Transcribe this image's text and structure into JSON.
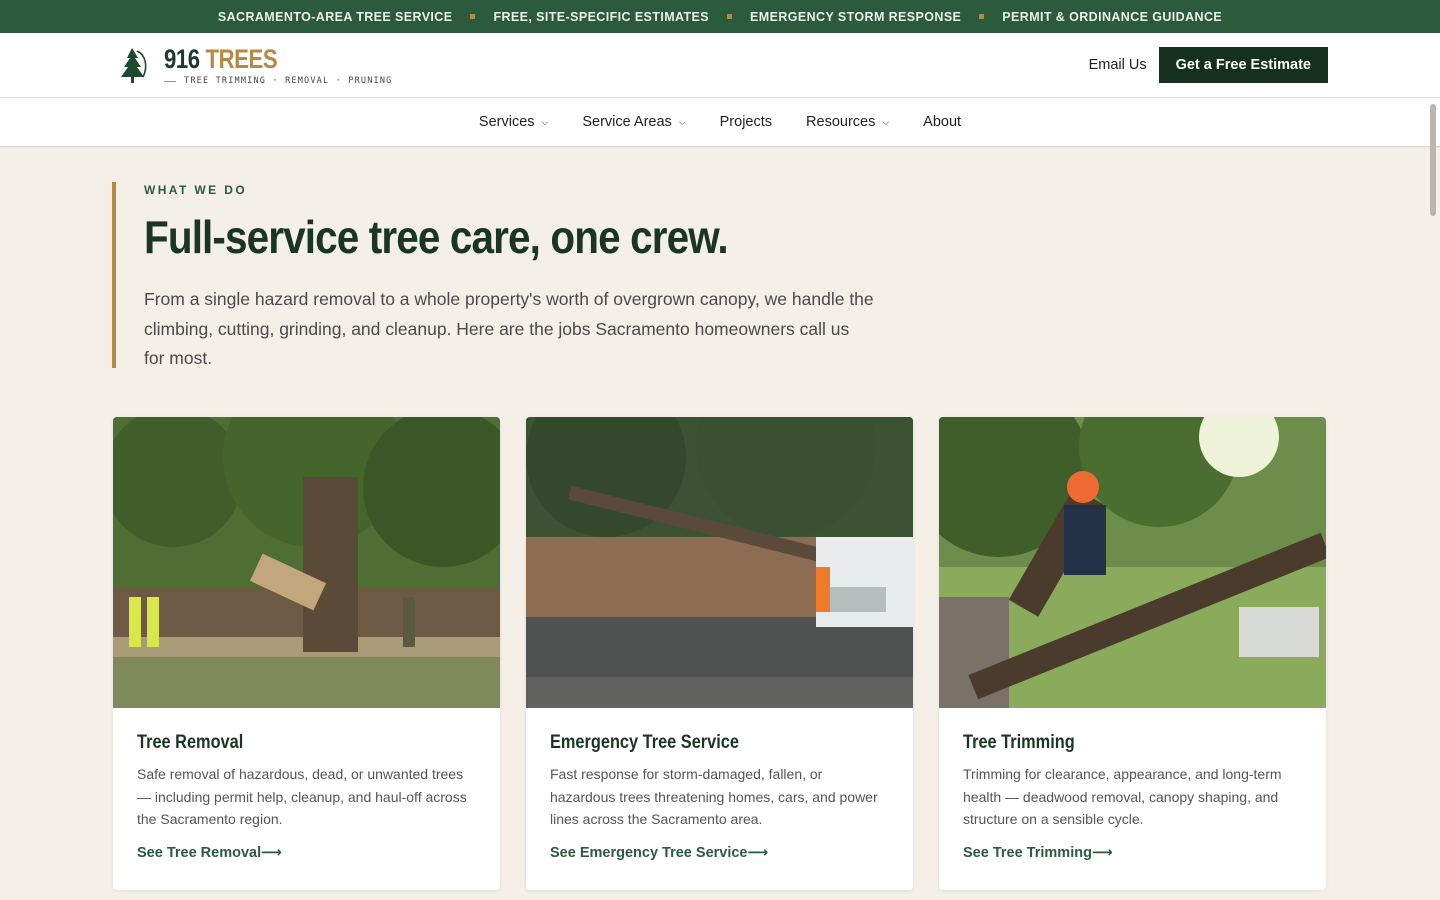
{
  "topbar": {
    "items": [
      "SACRAMENTO-AREA TREE SERVICE",
      "FREE, SITE-SPECIFIC ESTIMATES",
      "EMERGENCY STORM RESPONSE",
      "PERMIT & ORDINANCE GUIDANCE"
    ]
  },
  "header": {
    "logo_number": "916",
    "logo_word": "TREES",
    "logo_tagline": "TREE TRIMMING · REMOVAL · PRUNING",
    "logo_icon": "pine-tree-icon",
    "email_label": "Email Us",
    "cta_label": "Get a Free Estimate"
  },
  "nav": {
    "items": [
      {
        "label": "Services",
        "dropdown": true
      },
      {
        "label": "Service Areas",
        "dropdown": true
      },
      {
        "label": "Projects",
        "dropdown": false
      },
      {
        "label": "Resources",
        "dropdown": true
      },
      {
        "label": "About",
        "dropdown": false
      }
    ]
  },
  "intro": {
    "eyebrow": "WHAT WE DO",
    "headline": "Full-service tree care, one crew.",
    "lede": "From a single hazard removal to a whole property's worth of overgrown canopy, we handle the climbing, cutting, grinding, and cleanup. Here are the jobs Sacramento homeowners call us for most."
  },
  "cards": [
    {
      "title": "Tree Removal",
      "text": "Safe removal of hazardous, dead, or unwanted trees — including permit help, cleanup, and haul-off across the Sacramento region.",
      "link": "See Tree Removal⟶"
    },
    {
      "title": "Emergency Tree Service",
      "text": "Fast response for storm-damaged, fallen, or hazardous trees threatening homes, cars, and power lines across the Sacramento area.",
      "link": "See Emergency Tree Service⟶"
    },
    {
      "title": "Tree Trimming",
      "text": "Trimming for clearance, appearance, and long-term health — deadwood removal, canopy shaping, and structure on a sensible cycle.",
      "link": "See Tree Trimming⟶"
    }
  ],
  "colors": {
    "brand_green": "#2c5a3c",
    "dark_green": "#16301f",
    "accent_gold": "#b58a43",
    "page_bg": "#f4f0e7"
  }
}
